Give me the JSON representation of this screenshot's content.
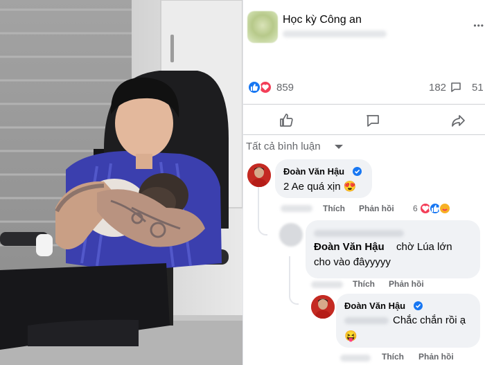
{
  "post": {
    "page_name": "Học kỳ Công an",
    "more": "•••"
  },
  "reactions": {
    "count": "859",
    "comments": "182",
    "shares": "51"
  },
  "filter": {
    "label": "Tất cả bình luận"
  },
  "comments": [
    {
      "author": "Đoàn Văn Hậu",
      "text": "2 Ae quá xịn",
      "emoji": "😍",
      "like_label": "Thích",
      "reply_label": "Phản hồi",
      "reaction_count": "6"
    },
    {
      "author": "Đoàn Văn Hậu",
      "text_line1": "chờ Lúa lớn",
      "text_line2": "cho vào đâyyyyy",
      "like_label": "Thích",
      "reply_label": "Phản hồi"
    },
    {
      "author": "Đoàn Văn Hậu",
      "text": "Chắc chắn rồi ạ",
      "emoji": "😝",
      "like_label": "Thích",
      "reply_label": "Phản hồi"
    }
  ],
  "colors": {
    "like_blue": "#1877f2",
    "love_red": "#f33e58",
    "bubble": "#f0f2f5",
    "meta_gray": "#65676b"
  }
}
